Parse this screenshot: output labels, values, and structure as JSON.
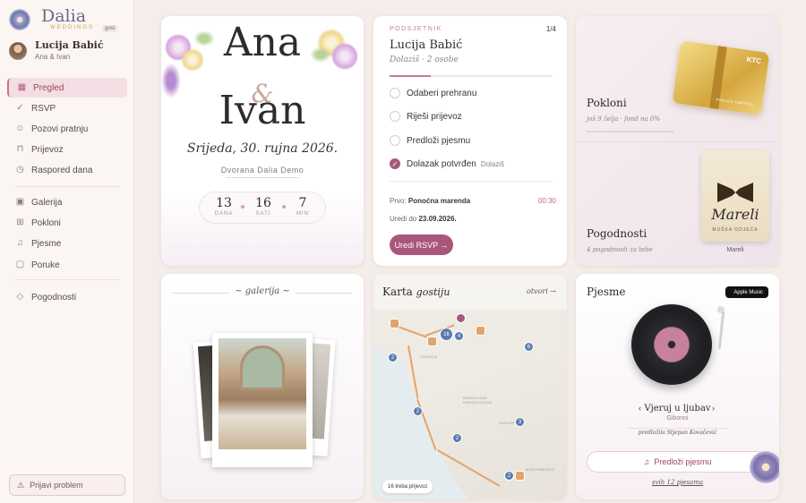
{
  "brand": {
    "name": "Dalia",
    "sub": "WEDDINGS",
    "tag": "gost"
  },
  "user": {
    "name": "Lucija Babić",
    "couple": "Ana & Ivan"
  },
  "nav": [
    {
      "label": "Pregled",
      "icon": "grid-icon",
      "active": true
    },
    {
      "label": "RSVP",
      "icon": "check-circle-icon"
    },
    {
      "label": "Pozovi pratnju",
      "icon": "user-plus-icon"
    },
    {
      "label": "Prijevoz",
      "icon": "car-icon"
    },
    {
      "label": "Raspored dana",
      "icon": "clock-icon"
    },
    {
      "label": "Galerija",
      "icon": "image-icon"
    },
    {
      "label": "Pokloni",
      "icon": "gift-icon"
    },
    {
      "label": "Pjesme",
      "icon": "music-icon"
    },
    {
      "label": "Poruke",
      "icon": "message-icon"
    },
    {
      "label": "Pogodnosti",
      "icon": "tag-icon"
    }
  ],
  "report_label": "Prijavi problem",
  "hero": {
    "name1": "Ana",
    "amp": "&",
    "name2": "Ivan",
    "date": "Srijeda, 30. rujna 2026.",
    "venue": "Dvorana Dalia Demo",
    "countdown": [
      {
        "n": "13",
        "l": "DANA"
      },
      {
        "n": "16",
        "l": "SATI"
      },
      {
        "n": "7",
        "l": "MIN"
      }
    ]
  },
  "reminder": {
    "label": "PODSJETNIK",
    "page": "1/4",
    "name": "Lucija Babić",
    "status": "Dolaziš · 2 osobe",
    "progress": 0.25,
    "tasks": [
      {
        "text": "Odaberi prehranu",
        "done": false
      },
      {
        "text": "Riješi prijevoz",
        "done": false
      },
      {
        "text": "Predloži pjesmu",
        "done": false
      },
      {
        "text": "Dolazak potvrđen",
        "done": true,
        "note": "Dolaziš"
      }
    ],
    "first_prefix": "Prvo:",
    "first": "Ponoćna marenda",
    "first_time": "00:30",
    "edit_prefix": "Uredi do",
    "edit_date": "23.09.2026.",
    "button": "Uredi RSVP →"
  },
  "gifts": {
    "title": "Pokloni",
    "sub": "još 9 želja · fond na 0%",
    "card_brand": "KTC",
    "card_text": "POKLON KARTICA",
    "perks_title": "Pogodnosti",
    "perks_sub": "4 pogodnosti za tebe",
    "partner": "Mareli",
    "partner_sub": "MUŠKA ODJEĆA",
    "partner_caption": "Mareli"
  },
  "gallery": {
    "title": "~ galerija ~"
  },
  "map": {
    "title": "Karta",
    "title_script": "gostiju",
    "link": "otvori →",
    "badge": "16 treba prijevoz",
    "pins": [
      "2",
      "4",
      "2",
      "3",
      "6",
      "2",
      "2",
      "16"
    ],
    "places": [
      "CROATIA",
      "BOSNIA AND HERZEGOVINA",
      "SARAJEVO",
      "MONTENEGRO"
    ]
  },
  "songs": {
    "title": "Pjesme",
    "service": "Apple Music",
    "song": "Vjeruj u ljubav",
    "artist": "Gibonni",
    "by": "predložila Stjepan Kovačević",
    "button": "Predloži pjesmu",
    "all": "svih 12 pjesama"
  }
}
